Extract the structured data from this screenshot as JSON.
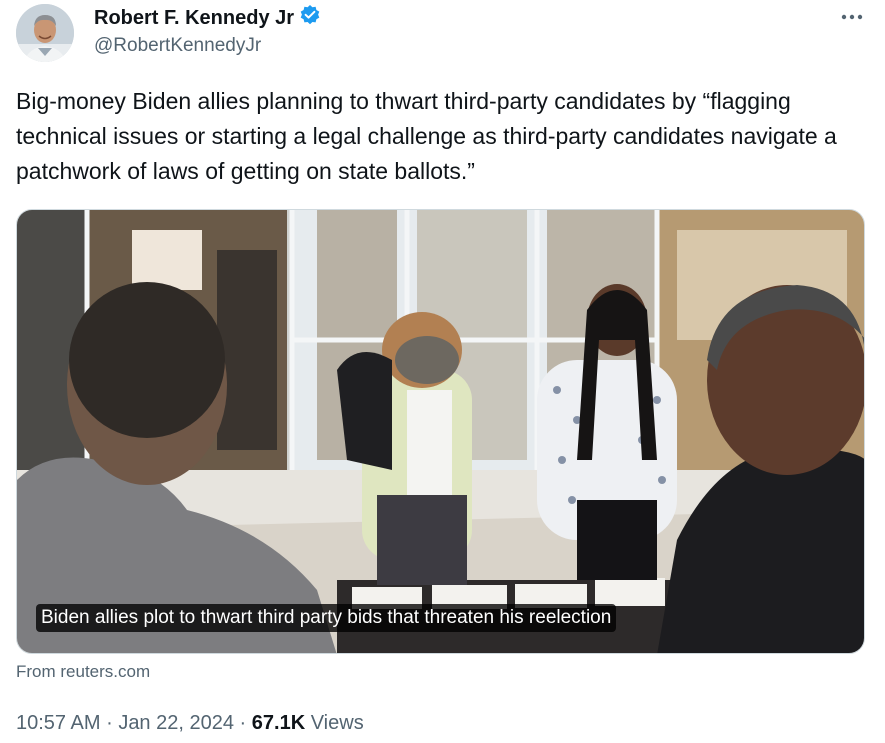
{
  "author": {
    "display_name": "Robert F. Kennedy Jr",
    "handle": "@RobertKennedyJr",
    "verified": true,
    "verified_color": "#1d9bf0"
  },
  "more_icon": "more-horizontal-icon",
  "tweet": {
    "text": "Big-money Biden allies planning to thwart third-party candidates by “flagging technical issues or starting a legal challenge as third-party candidates navigate a patchwork of laws of getting on state ballots.”"
  },
  "link_card": {
    "title": "Biden allies plot to thwart third party bids that threaten his reelection",
    "source": "From reuters.com"
  },
  "meta": {
    "time": "10:57 AM",
    "separator": "·",
    "date": "Jan 22, 2024",
    "views_count": "67.1K",
    "views_label": "Views"
  }
}
